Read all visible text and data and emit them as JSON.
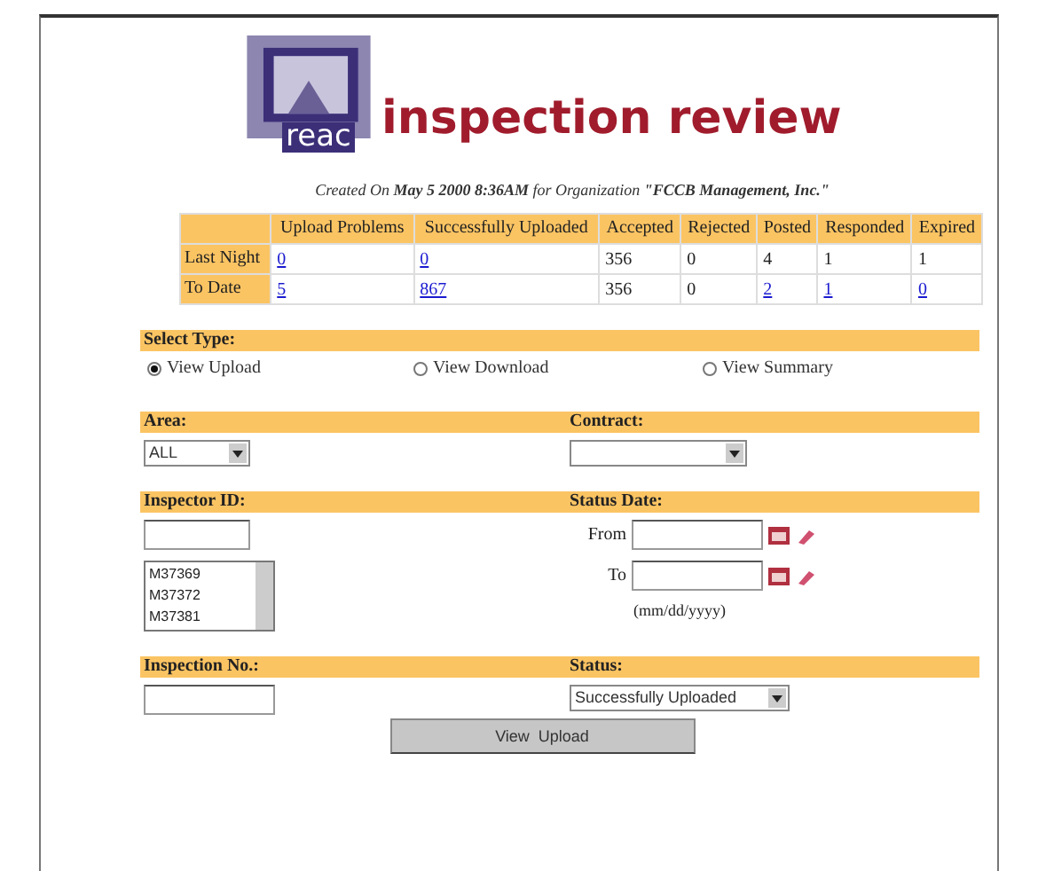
{
  "header": {
    "logo_text": "reac",
    "title": "inspection review",
    "created": "Created On **May 5 2000 8:36AM** for Organization **\"FCCB Management, Inc.\"**"
  },
  "summary": {
    "columns": [
      "",
      "Upload Problems",
      "Successfully Uploaded",
      "Accepted",
      "Rejected",
      "Posted",
      "Responded",
      "Expired"
    ],
    "rows": [
      {
        "cells": [
          {
            "text": "Last Night",
            "kind": "label"
          },
          {
            "text": "0",
            "link": true
          },
          {
            "text": "0",
            "link": true
          },
          {
            "text": "356",
            "link": false
          },
          {
            "text": "0",
            "link": false
          },
          {
            "text": "4",
            "link": false
          },
          {
            "text": "1",
            "link": false
          },
          {
            "text": "1",
            "link": false
          }
        ]
      },
      {
        "cells": [
          {
            "text": "To Date",
            "kind": "label"
          },
          {
            "text": "5",
            "link": true
          },
          {
            "text": "867",
            "link": true
          },
          {
            "text": "356",
            "link": false
          },
          {
            "text": "0",
            "link": false
          },
          {
            "text": "2",
            "link": true
          },
          {
            "text": "1",
            "link": true
          },
          {
            "text": "0",
            "link": true
          }
        ]
      }
    ]
  },
  "select_type": {
    "label": "Select Type:",
    "options": [
      {
        "label": "View Upload",
        "selected": true
      },
      {
        "label": "View Download",
        "selected": false
      },
      {
        "label": "View Summary",
        "selected": false
      }
    ]
  },
  "area": {
    "label": "Area:",
    "value": "ALL"
  },
  "contract": {
    "label": "Contract:"
  },
  "inspector": {
    "label": "Inspector ID:",
    "items": [
      "M37369",
      "M37372",
      "M37381"
    ]
  },
  "status_date": {
    "label": "Status Date:",
    "from_label": "From",
    "to_label": "To",
    "hint": "(mm/dd/yyyy)"
  },
  "inspection_no": {
    "label": "Inspection No.:"
  },
  "status": {
    "label": "Status:",
    "value": "Successfully Uploaded"
  },
  "submit": "View  Upload"
}
